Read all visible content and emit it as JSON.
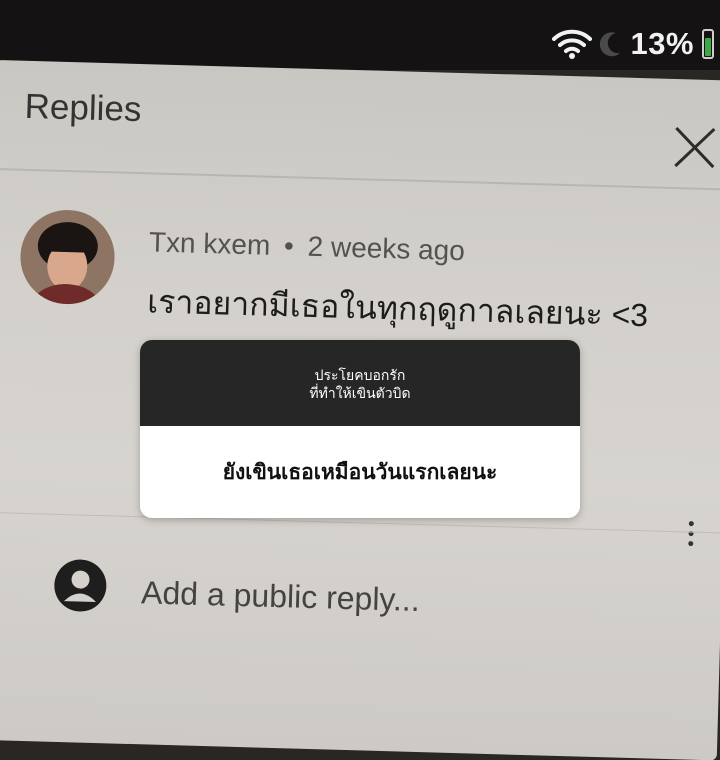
{
  "status_bar": {
    "battery_percent": "13%",
    "battery_level": 0.13,
    "icons": [
      "wifi-icon",
      "moon-icon",
      "battery-icon"
    ],
    "battery_color": "#3ea944"
  },
  "replies_panel": {
    "title": "Replies",
    "close_icon": "close-icon",
    "reply": {
      "author": "Txn kxem",
      "separator": "•",
      "time": "2 weeks ago",
      "text": "เราอยากมีเธอในทุกฤดูกาลเลยนะ <3"
    },
    "input": {
      "placeholder": "Add a public reply..."
    }
  },
  "overlay_card": {
    "header_line1": "ประโยคบอกรัก",
    "header_line2": "ที่ทำให้เขินตัวบิด",
    "body": "ยังเขินเธอเหมือนวันแรกเลยนะ",
    "header_color": "#262626",
    "body_color": "#ffffff"
  }
}
